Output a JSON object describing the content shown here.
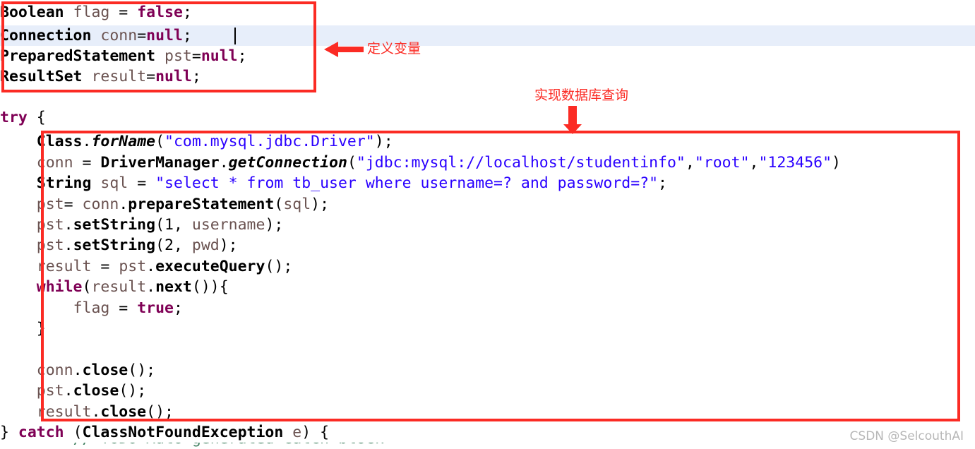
{
  "editor": {
    "language": "java",
    "font_size_px": 21.5,
    "line_height_px": 29,
    "background": "#ffffff",
    "current_line_highlight_color": "#e7eefa",
    "current_line_index": 1,
    "caret_visible": true,
    "colors": {
      "type": "#000000",
      "keyword": "#7f0055",
      "variable": "#6a5250",
      "string": "#2a00ff",
      "method": "#000000",
      "comment": "#3f7f5f",
      "annotation_red": "#fb2b24",
      "watermark_gray": "#b7b7b7"
    },
    "lines": [
      {
        "indent": "",
        "text": "Boolean flag = false;"
      },
      {
        "indent": "",
        "text": "Connection conn=null;"
      },
      {
        "indent": "",
        "text": "PreparedStatement pst=null;"
      },
      {
        "indent": "",
        "text": "ResultSet result=null;"
      },
      {
        "indent": "",
        "text": ""
      },
      {
        "indent": "",
        "text": "try {"
      },
      {
        "indent": "    ",
        "text": "Class.forName(\"com.mysql.jdbc.Driver\");"
      },
      {
        "indent": "    ",
        "text": "conn = DriverManager.getConnection(\"jdbc:mysql://localhost/studentinfo\",\"root\",\"123456\")"
      },
      {
        "indent": "    ",
        "text": "String sql = \"select * from tb_user where username=? and password=?\";"
      },
      {
        "indent": "    ",
        "text": "pst= conn.prepareStatement(sql);"
      },
      {
        "indent": "    ",
        "text": "pst.setString(1, username);"
      },
      {
        "indent": "    ",
        "text": "pst.setString(2, pwd);"
      },
      {
        "indent": "    ",
        "text": "result = pst.executeQuery();"
      },
      {
        "indent": "    ",
        "text": "while(result.next()){"
      },
      {
        "indent": "        ",
        "text": "flag = true;"
      },
      {
        "indent": "    ",
        "text": "}"
      },
      {
        "indent": "",
        "text": ""
      },
      {
        "indent": "    ",
        "text": "conn.close();"
      },
      {
        "indent": "    ",
        "text": "pst.close();"
      },
      {
        "indent": "    ",
        "text": "result.close();"
      },
      {
        "indent": "",
        "text": "} catch (ClassNotFoundException e) {"
      }
    ]
  },
  "annotations": {
    "boxes": [
      {
        "name": "declarations",
        "color": "#fb2b24"
      },
      {
        "name": "database-query",
        "color": "#fb2b24"
      }
    ],
    "define_variables_label": "定义变量",
    "database_query_label": "实现数据库查询",
    "arrow_left_direction": "left",
    "arrow_down_direction": "down"
  },
  "watermark": {
    "text": "CSDN @SelcouthAI"
  }
}
